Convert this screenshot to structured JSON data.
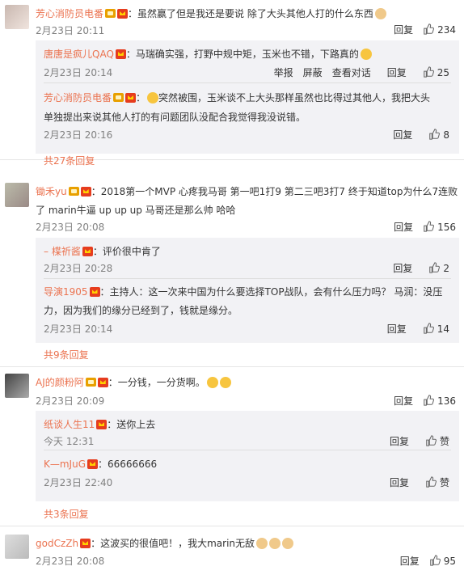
{
  "icons": {
    "reply_like": "thumbs-up-icon",
    "vip": "vip-crown-icon",
    "badge": "fan-badge-icon"
  },
  "colors": {
    "name": "#eb7350",
    "meta": "#808080",
    "reply_bg": "#f2f2f5"
  },
  "posts": [
    {
      "user": "芳心消防员电番",
      "text": "：虽然赢了但是我还是要说 除了大头其他人打的什么东西",
      "time": "2月23日 20:11",
      "reply": "回复",
      "likes": "234",
      "subs": [
        {
          "user": "唐唐是疯儿QAQ",
          "text": "：马瑞确实强，打野中规中矩，玉米也不错，下路真的",
          "time": "2月23日 20:14",
          "report": "举报",
          "block": "屏蔽",
          "view": "查看对话",
          "reply": "回复",
          "likes": "25"
        },
        {
          "user": "芳心消防员电番",
          "text1": "：",
          "text2": "突然被围，玉米谈不上大头那样虽然也比得过其他人，我把大头",
          "text3": "单独提出来说其他人打的有问题团队没配合我觉得我没说错。",
          "time": "2月23日 20:16",
          "reply": "回复",
          "likes": "8"
        }
      ],
      "more": "共27条回复"
    },
    {
      "user": "锄禾yu",
      "text1": "：2018第一个MVP 心疼我马哥 第一吧1打9 第二三吧3打7 终于知道top为什么7连败",
      "text2": "了 marin牛逼 up up up 马哥还是那么帅 哈哈",
      "time": "2月23日 20:08",
      "reply": "回复",
      "likes": "156",
      "subs": [
        {
          "user": "楪祈酱",
          "text": "：评价很中肯了",
          "time": "2月23日 20:28",
          "reply": "回复",
          "likes": "2"
        },
        {
          "user": "导演1905",
          "text1": "：主持人：这一次来中国为什么要选择TOP战队，会有什么压力吗？ 马润：没压",
          "text2": "力，因为我们的缘分已经到了，钱就是缘分。",
          "time": "2月23日 20:14",
          "reply": "回复",
          "likes": "14"
        }
      ],
      "more": "共9条回复"
    },
    {
      "user": "AJ的颜粉阿",
      "text": "：一分钱，一分货啊。",
      "time": "2月23日 20:09",
      "reply": "回复",
      "likes": "136",
      "subs": [
        {
          "user": "纸谈人生11",
          "text": "：送你上去",
          "time": "今天 12:31",
          "reply": "回复",
          "likes": "赞"
        },
        {
          "user": "K—mJuG",
          "text": "：66666666",
          "time": "2月23日 22:40",
          "reply": "回复",
          "likes": "赞"
        }
      ],
      "more": "共3条回复"
    },
    {
      "user": "godCzZh",
      "text": "：这波买的很值吧！，我大marin无敌",
      "time": "2月23日 20:08",
      "reply": "回复",
      "likes": "95"
    }
  ]
}
